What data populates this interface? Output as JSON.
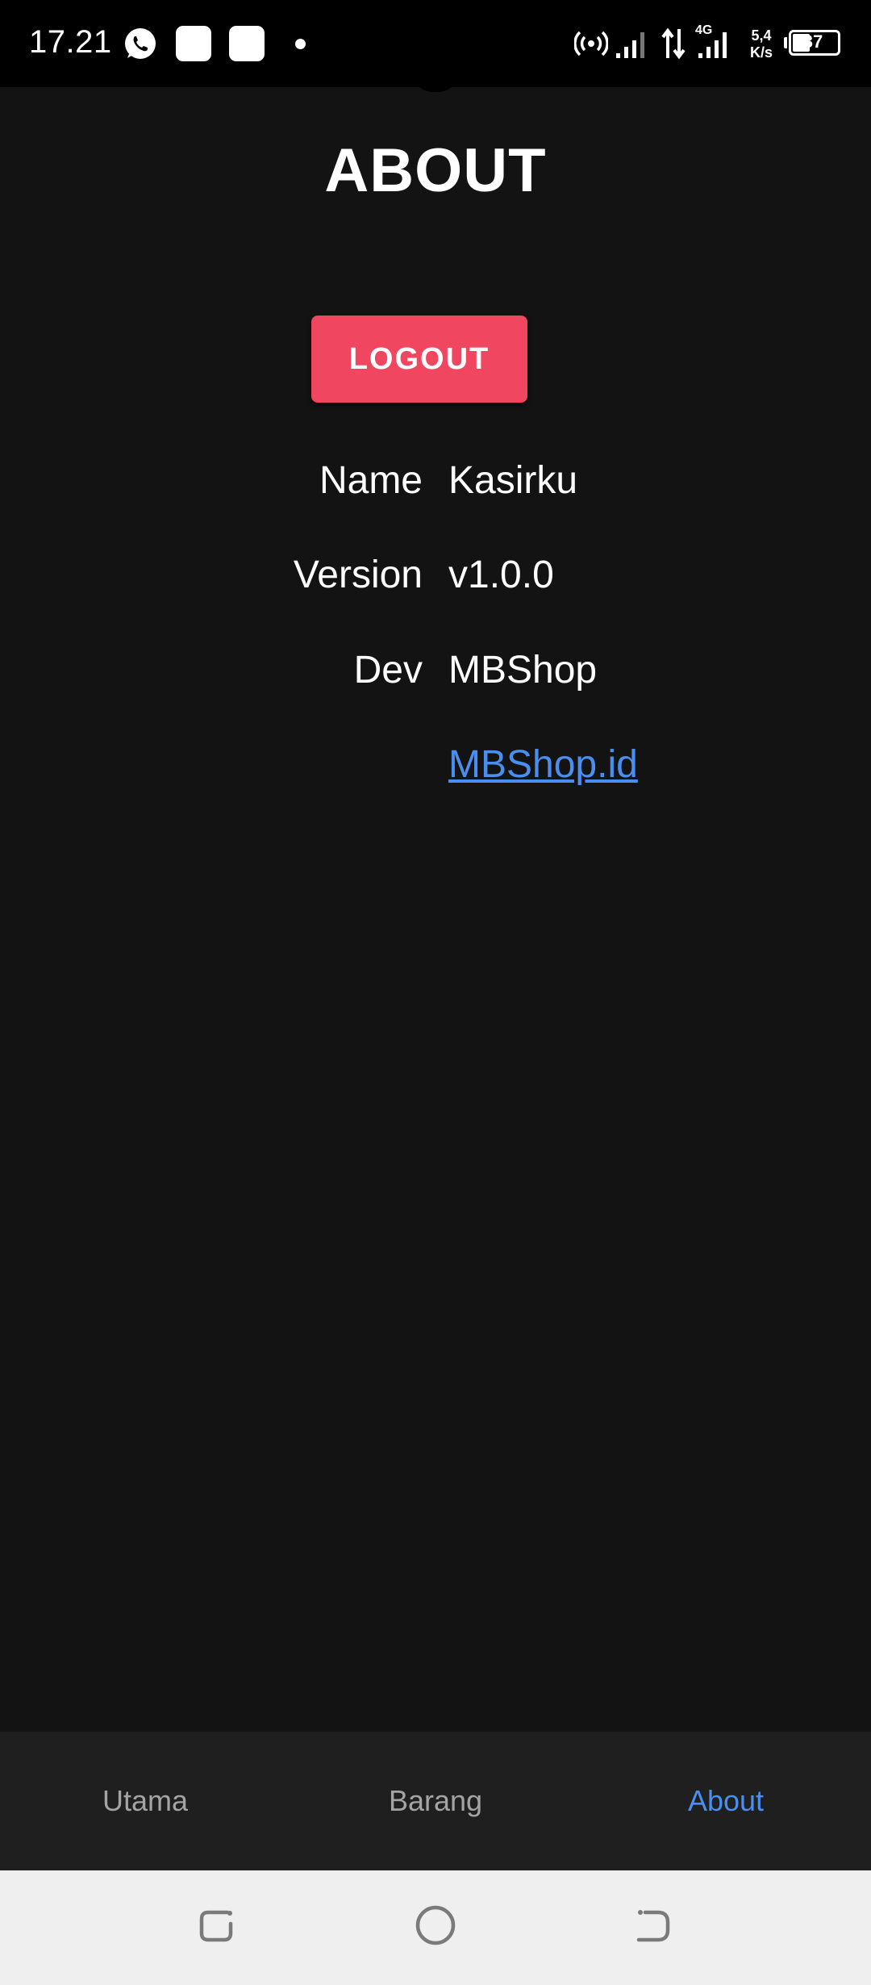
{
  "status_bar": {
    "time": "17.21",
    "network_speed_value": "5,4",
    "network_speed_unit": "K/s",
    "network_type": "4G",
    "battery_level": "37",
    "battery_fraction": 0.37,
    "icons": [
      "whatsapp-icon",
      "notification-square-icon",
      "notification-square-icon",
      "dot-icon",
      "hotspot-icon",
      "signal-icon",
      "data-arrows-icon",
      "signal-4g-icon",
      "battery-icon"
    ]
  },
  "page": {
    "title": "ABOUT",
    "logout_label": "LOGOUT",
    "info": {
      "name_label": "Name",
      "name_value": "Kasirku",
      "version_label": "Version",
      "version_value": "v1.0.0",
      "dev_label": "Dev",
      "dev_value": "MBShop",
      "link": "MBShop.id"
    }
  },
  "bottom_nav": {
    "items": [
      {
        "label": "Utama",
        "active": false
      },
      {
        "label": "Barang",
        "active": false
      },
      {
        "label": "About",
        "active": true
      }
    ]
  },
  "system_nav": {
    "icons": [
      "recent-apps-icon",
      "home-icon",
      "back-icon"
    ]
  },
  "colors": {
    "background": "#131313",
    "accent_button": "#f04660",
    "link": "#4a8ff0",
    "nav_background": "#1f1f1f",
    "nav_inactive": "#a4a4a4",
    "system_nav_background": "#efefef"
  }
}
